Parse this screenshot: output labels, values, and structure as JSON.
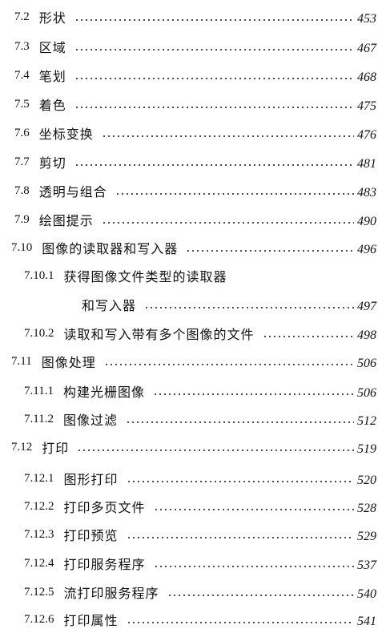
{
  "toc": {
    "entries": [
      {
        "num": "7.2",
        "title": "形状",
        "page": "453"
      },
      {
        "num": "7.3",
        "title": "区域",
        "page": "467"
      },
      {
        "num": "7.4",
        "title": "笔划",
        "page": "468"
      },
      {
        "num": "7.5",
        "title": "着色",
        "page": "475"
      },
      {
        "num": "7.6",
        "title": "坐标变换",
        "page": "476"
      },
      {
        "num": "7.7",
        "title": "剪切",
        "page": "481"
      },
      {
        "num": "7.8",
        "title": "透明与组合",
        "page": "483"
      },
      {
        "num": "7.9",
        "title": "绘图提示",
        "page": "490"
      },
      {
        "num": "7.10",
        "title": "图像的读取器和写入器",
        "page": "496"
      },
      {
        "num": "7.10.1",
        "title": "获得图像文件类型的读取器",
        "page": ""
      },
      {
        "num": "",
        "title": "和写入器",
        "page": "497"
      },
      {
        "num": "7.10.2",
        "title": "读取和写入带有多个图像的文件",
        "page": "498"
      },
      {
        "num": "7.11",
        "title": "图像处理",
        "page": "506"
      },
      {
        "num": "7.11.1",
        "title": "构建光栅图像",
        "page": "506"
      },
      {
        "num": "7.11.2",
        "title": "图像过滤",
        "page": "512"
      },
      {
        "num": "7.12",
        "title": "打印",
        "page": "519"
      },
      {
        "num": "7.12.1",
        "title": "图形打印",
        "page": "520"
      },
      {
        "num": "7.12.2",
        "title": "打印多页文件",
        "page": "528"
      },
      {
        "num": "7.12.3",
        "title": "打印预览",
        "page": "529"
      },
      {
        "num": "7.12.4",
        "title": "打印服务程序",
        "page": "537"
      },
      {
        "num": "7.12.5",
        "title": "流打印服务程序",
        "page": "540"
      },
      {
        "num": "7.12.6",
        "title": "打印属性",
        "page": "541"
      }
    ]
  }
}
